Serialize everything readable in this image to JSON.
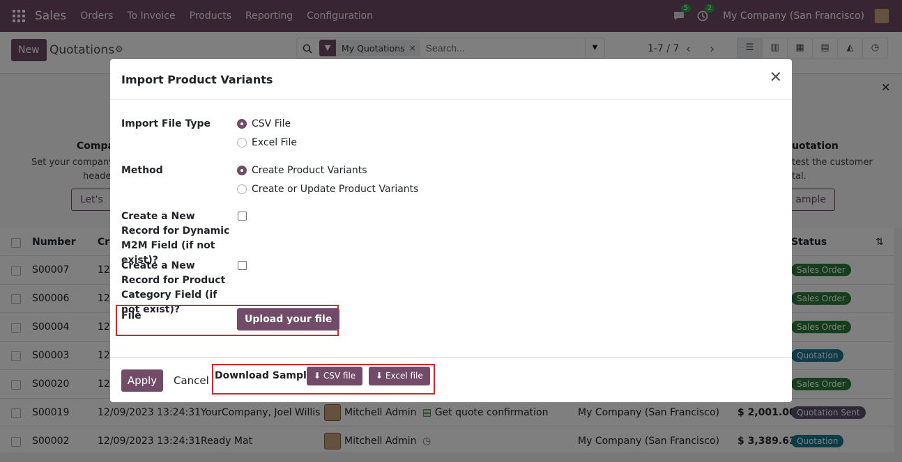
{
  "navbar": {
    "app": "Sales",
    "menus": [
      "Orders",
      "To Invoice",
      "Products",
      "Reporting",
      "Configuration"
    ],
    "messages_count": "5",
    "activities_count": "2",
    "company": "My Company (San Francisco)"
  },
  "control": {
    "new_label": "New",
    "title": "Quotations",
    "facet": "My Quotations",
    "search_placeholder": "Search...",
    "pager": "1-7 / 7"
  },
  "helper": {
    "left_title": "Compa",
    "left_line1": "Set your company's",
    "left_line2": "header",
    "left_button": "Let's",
    "right_title": "uotation",
    "right_line1": "test the customer",
    "right_line2": "tal.",
    "right_button": "ample"
  },
  "table": {
    "headers": {
      "number": "Number",
      "creation": "Cre",
      "status": "Status"
    },
    "rows": [
      {
        "number": "S00007",
        "date": "12/",
        "customer": "",
        "salesperson": "",
        "activity": "",
        "company": "",
        "total": "",
        "status": "Sales Order",
        "status_color": "green"
      },
      {
        "number": "S00006",
        "date": "12/",
        "customer": "",
        "salesperson": "",
        "activity": "",
        "company": "",
        "total": "",
        "status": "Sales Order",
        "status_color": "green"
      },
      {
        "number": "S00004",
        "date": "12/",
        "customer": "",
        "salesperson": "",
        "activity": "",
        "company": "",
        "total": "",
        "status": "Sales Order",
        "status_color": "green"
      },
      {
        "number": "S00003",
        "date": "12/",
        "customer": "",
        "salesperson": "",
        "activity": "",
        "company": "",
        "total": "",
        "status": "Quotation",
        "status_color": "blue"
      },
      {
        "number": "S00020",
        "date": "12/",
        "customer": "",
        "salesperson": "",
        "activity": "",
        "company": "",
        "total": "",
        "status": "Sales Order",
        "status_color": "green"
      },
      {
        "number": "S00019",
        "date": "12/09/2023 13:24:31",
        "customer": "YourCompany, Joel Willis",
        "salesperson": "Mitchell Admin",
        "activity": "Get quote confirmation",
        "company": "My Company (San Francisco)",
        "total": "$ 2,001.00",
        "status": "Quotation Sent",
        "status_color": "purple"
      },
      {
        "number": "S00002",
        "date": "12/09/2023 13:24:31",
        "customer": "Ready Mat",
        "salesperson": "Mitchell Admin",
        "activity": "",
        "company": "My Company (San Francisco)",
        "total": "$ 3,389.63",
        "status": "Quotation",
        "status_color": "blue"
      }
    ]
  },
  "modal": {
    "title": "Import Product Variants",
    "file_type_label": "Import File Type",
    "file_type_options": [
      "CSV File",
      "Excel File"
    ],
    "file_type_selected": "CSV File",
    "method_label": "Method",
    "method_options": [
      "Create Product Variants",
      "Create or Update Product Variants"
    ],
    "method_selected": "Create Product Variants",
    "m2m_label": "Create a New Record for Dynamic M2M Field (if not exist)?",
    "m2m_checked": false,
    "category_label": "Create a New Record for Product Category Field (if not exist)?",
    "category_checked": false,
    "file_label": "File",
    "upload_button": "Upload your file",
    "apply_button": "Apply",
    "cancel_button": "Cancel",
    "download_label": "Download Sample:",
    "csv_button": "CSV file",
    "excel_button": "Excel file"
  },
  "colors": {
    "brand": "#714B67",
    "highlight": "#d9232d"
  }
}
